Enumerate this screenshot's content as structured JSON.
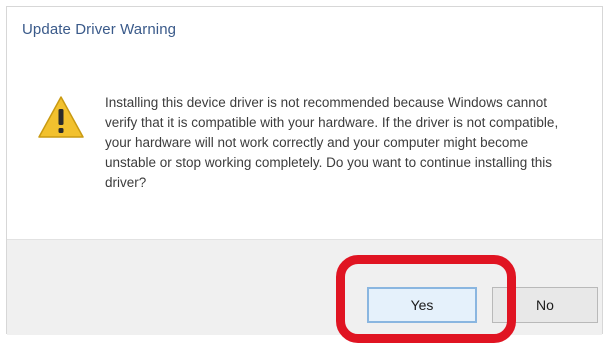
{
  "dialog": {
    "title": "Update Driver Warning",
    "message": "Installing this device driver is not recommended because Windows cannot verify that it is compatible with your hardware. If the driver is not compatible, your hardware will not work correctly and your computer might become unstable or stop working completely. Do you want to continue installing this driver?",
    "icon": "warning-icon",
    "buttons": {
      "yes_label": "Yes",
      "no_label": "No"
    }
  },
  "annotation": {
    "highlight_color": "#e01422",
    "highlight_target": "yes-button"
  },
  "colors": {
    "title_text": "#3a5a8a",
    "warning_yellow": "#f2c12e",
    "footer_bg": "#f0f0f0",
    "default_button_border": "#8ab6e0"
  }
}
